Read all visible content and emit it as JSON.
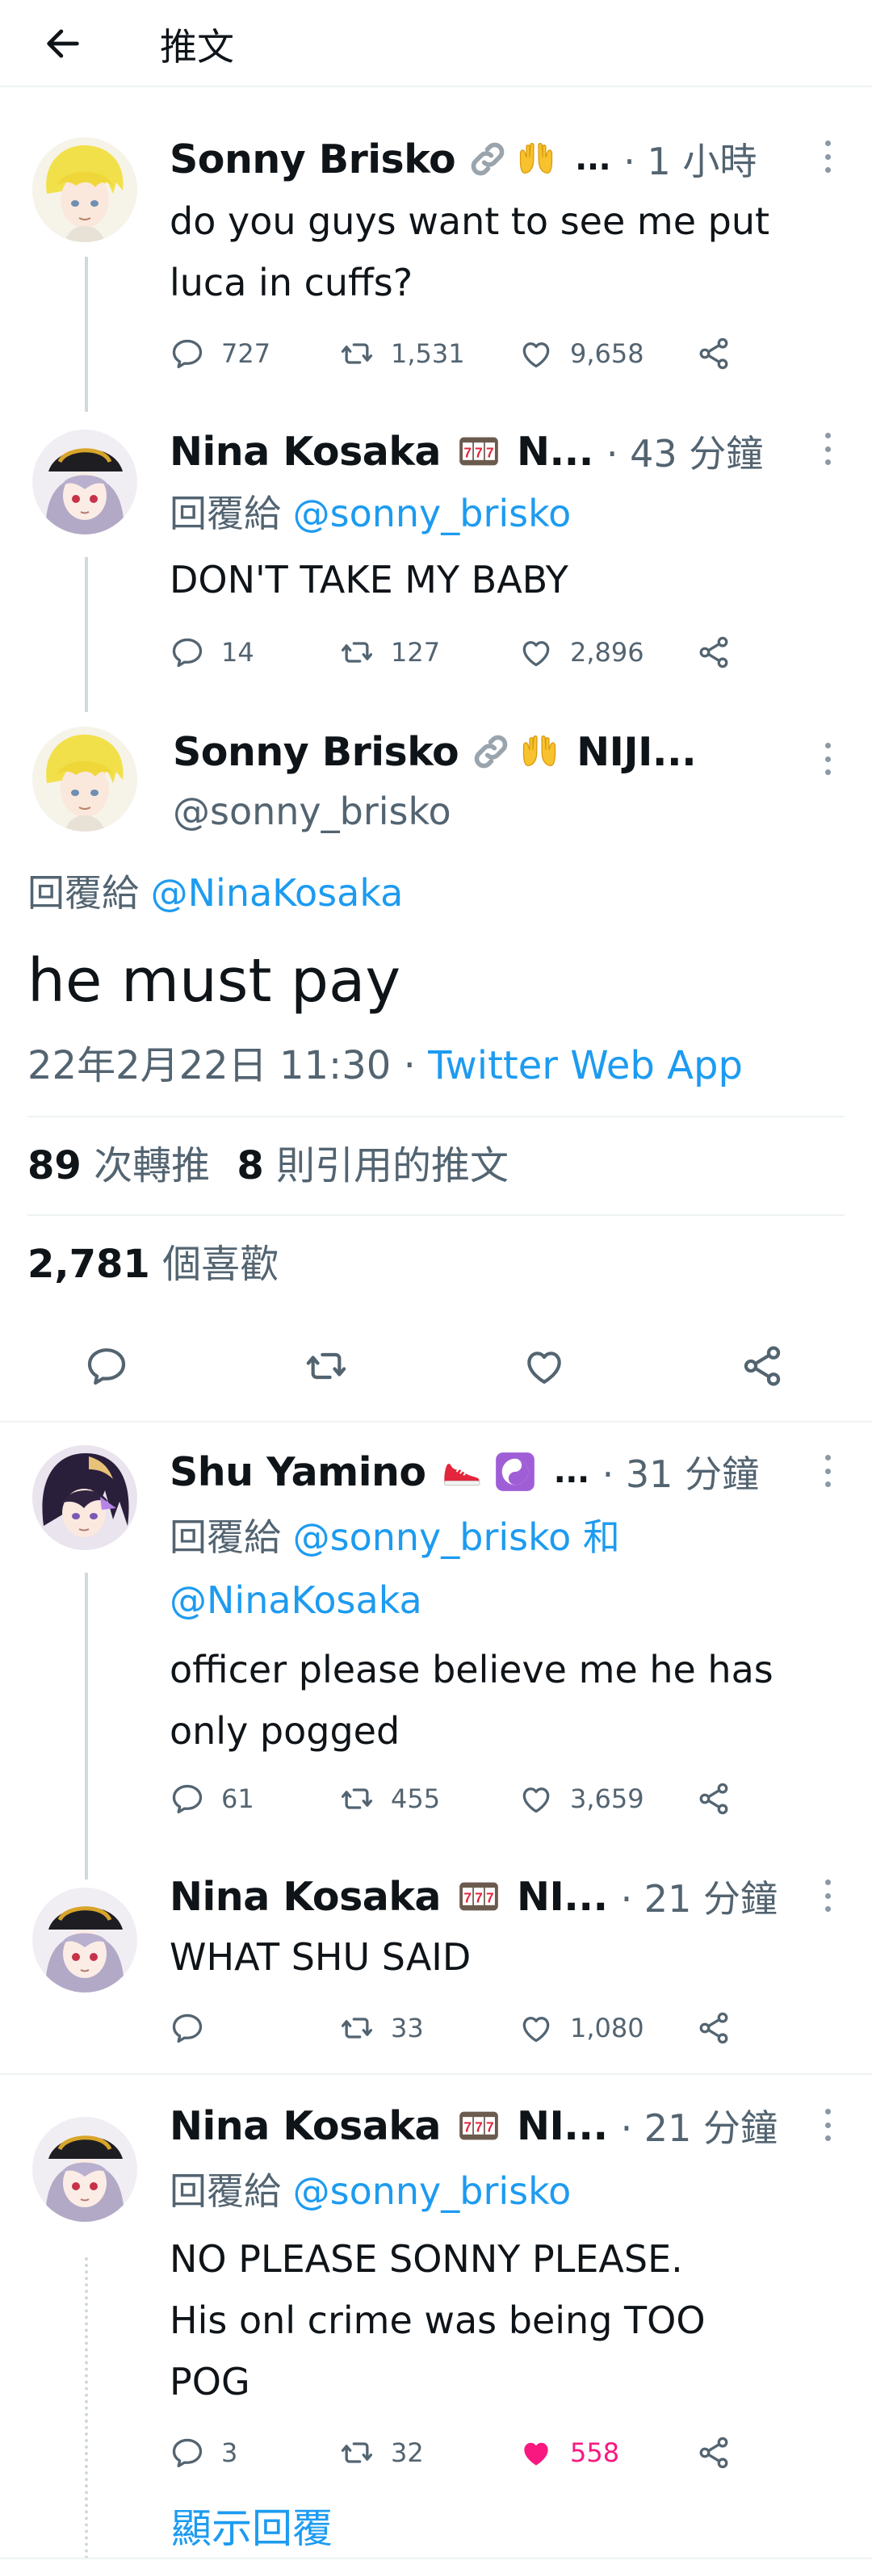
{
  "header": {
    "title": "推文"
  },
  "tweets": [
    {
      "name": "Sonny Brisko",
      "name_suffix": "...",
      "time": "· 1 小時",
      "text_lines": [
        "do you guys want to see me put",
        "luca in cuffs?"
      ],
      "replies": "727",
      "retweets": "1,531",
      "likes": "9,658"
    },
    {
      "name": "Nina Kosaka",
      "name_suffix": "N...",
      "time": "· 43 分鐘",
      "reply_prefix": "回覆給",
      "reply_to": "@sonny_brisko",
      "text_lines": [
        "DON'T TAKE MY BABY"
      ],
      "replies": "14",
      "retweets": "127",
      "likes": "2,896"
    }
  ],
  "main_tweet": {
    "name": "Sonny Brisko",
    "name_suffix": "NIJI...",
    "handle": "@sonny_brisko",
    "reply_prefix": "回覆給",
    "reply_to": "@NinaKosaka",
    "text": "he must pay",
    "timestamp": "22年2月22日 11:30",
    "source_sep": "·",
    "source": "Twitter Web App",
    "retweets_count": "89",
    "retweets_label": "次轉推",
    "quotes_count": "8",
    "quotes_label": "則引用的推文",
    "likes_count": "2,781",
    "likes_label": "個喜歡"
  },
  "replies": [
    {
      "name": "Shu Yamino",
      "name_suffix": "...",
      "time": "· 31 分鐘",
      "reply_prefix": "回覆給",
      "reply_to": "@sonny_brisko",
      "reply_and": "和",
      "reply_to2": "@NinaKosaka",
      "text_lines": [
        "officer please believe me he has",
        "only pogged"
      ],
      "replies": "61",
      "retweets": "455",
      "likes": "3,659"
    },
    {
      "name": "Nina Kosaka",
      "name_suffix": "NI...",
      "time": "· 21 分鐘",
      "text_lines": [
        "WHAT SHU SAID"
      ],
      "replies": "",
      "retweets": "33",
      "likes": "1,080"
    },
    {
      "name": "Nina Kosaka",
      "name_suffix": "NI...",
      "time": "· 21 分鐘",
      "reply_prefix": "回覆給",
      "reply_to": "@sonny_brisko",
      "text_lines": [
        "NO PLEASE SONNY PLEASE.",
        "His onl crime was being TOO",
        "POG"
      ],
      "replies": "3",
      "retweets": "32",
      "likes": "558"
    }
  ],
  "show_replies": "顯示回覆",
  "colors": {
    "link": "#1d9bf0",
    "text": "#0f1419",
    "muted": "#536471",
    "like_active": "#f91880",
    "divider": "#eff3f4"
  },
  "icons": [
    "back-arrow-icon",
    "reply-icon",
    "retweet-icon",
    "like-icon",
    "share-icon",
    "more-icon",
    "link-emoji-icon",
    "hands-emoji-icon",
    "slot-emoji-icon",
    "shoe-emoji-icon",
    "yin-yang-emoji-icon"
  ]
}
